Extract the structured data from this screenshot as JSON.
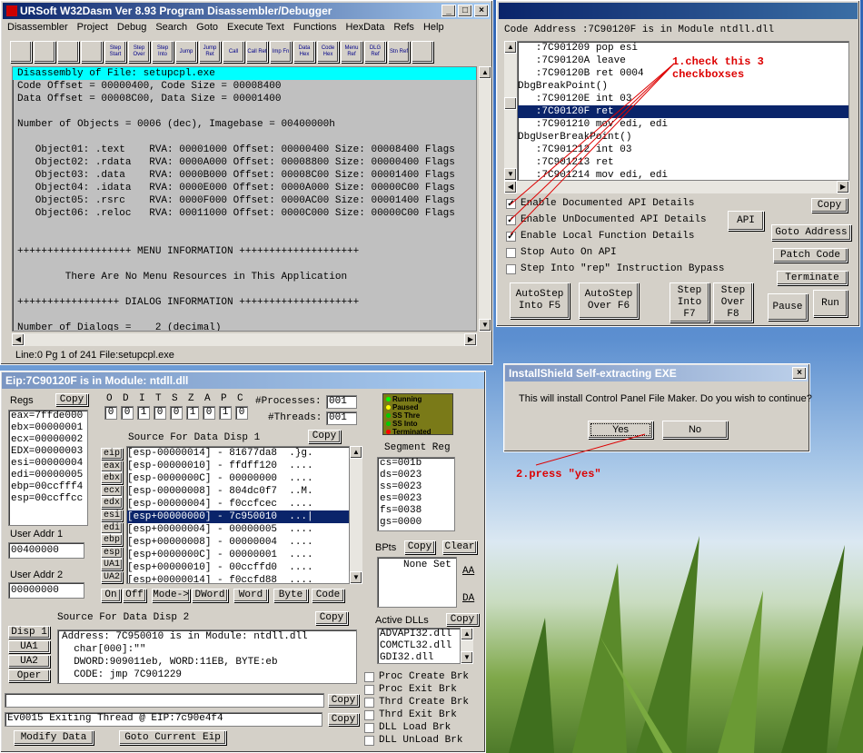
{
  "w32dasm": {
    "title": "URSoft W32Dasm Ver 8.93 Program Disassembler/Debugger",
    "menu": [
      "Disassembler",
      "Project",
      "Debug",
      "Search",
      "Goto",
      "Execute Text",
      "Functions",
      "HexData",
      "Refs",
      "Help"
    ],
    "toolbar": [
      "",
      "",
      "",
      "",
      "Step Start",
      "Step Over",
      "Step Into",
      "Jump",
      "Jump Ret",
      "Call",
      "Call Ret",
      "Imp Fn",
      "Data Hex",
      "Code Hex",
      "Menu Ref",
      "DLG Ref",
      "Stn Ref",
      ""
    ],
    "lines": [
      "Disassembly of File: setupcpl.exe",
      "Code Offset = 00000400, Code Size = 00008400",
      "Data Offset = 00008C00, Data Size = 00001400",
      "",
      "Number of Objects = 0006 (dec), Imagebase = 00400000h",
      "",
      "   Object01: .text    RVA: 00001000 Offset: 00000400 Size: 00008400 Flags",
      "   Object02: .rdata   RVA: 0000A000 Offset: 00008800 Size: 00000400 Flags",
      "   Object03: .data    RVA: 0000B000 Offset: 00008C00 Size: 00001400 Flags",
      "   Object04: .idata   RVA: 0000E000 Offset: 0000A000 Size: 00000C00 Flags",
      "   Object05: .rsrc    RVA: 0000F000 Offset: 0000AC00 Size: 00001400 Flags",
      "   Object06: .reloc   RVA: 00011000 Offset: 0000C000 Size: 00000C00 Flags",
      "",
      "",
      "+++++++++++++++++++ MENU INFORMATION ++++++++++++++++++++",
      "",
      "        There Are No Menu Resources in This Application",
      "",
      "+++++++++++++++++ DIALOG INFORMATION ++++++++++++++++++++",
      "",
      "Number of Dialogs =    2 (decimal)"
    ],
    "status": "Line:0 Pg 1 of 241  File:setupcpl.exe"
  },
  "code": {
    "address": "Code Address :7C90120F is in Module ntdll.dll",
    "lines": [
      "   :7C901209 pop esi",
      "   :7C90120A leave",
      "   :7C90120B ret 0004",
      "DbgBreakPoint()",
      "   :7C90120E int 03",
      "   :7C90120F ret",
      "   :7C901210 mov edi, edi",
      "DbgUserBreakPoint()",
      "   :7C901212 int 03",
      "   :7C901213 ret",
      "   :7C901214 mov edi, edi"
    ],
    "options": [
      {
        "label": "Enable Documented API Details",
        "checked": "✓"
      },
      {
        "label": "Enable UnDocumented API Details",
        "checked": "✓"
      },
      {
        "label": "Enable Local Function Details",
        "checked": "✓"
      },
      {
        "label": "Stop Auto On API",
        "checked": ""
      },
      {
        "label": "Step Into \"rep\" Instruction Bypass",
        "checked": ""
      }
    ],
    "buttons": {
      "copy": "Copy",
      "api": "API",
      "goto": "Goto Address",
      "patch": "Patch Code",
      "terminate": "Terminate",
      "pause": "Pause",
      "run": "Run",
      "as_into": "AutoStep Into F5",
      "as_over": "AutoStep Over F6",
      "step_into": "Step Into F7",
      "step_over": "Step Over F8"
    },
    "annotation1": "1.check this 3",
    "annotation1b": "checkboxses"
  },
  "regs": {
    "title": "Eip:7C90120F is in Module: ntdll.dll",
    "regs_label": "Regs",
    "copy": "Copy",
    "values": [
      "eax=7ffde000",
      "ebx=00000001",
      "ecx=00000002",
      "EDX=00000003",
      "esi=00000004",
      "edi=00000005",
      "ebp=00ccfff4",
      "esp=00ccffcc"
    ],
    "flags_letters": [
      "O",
      "D",
      "I",
      "T",
      "S",
      "Z",
      "A",
      "P",
      "C"
    ],
    "flags_values": [
      "0",
      "0",
      "1",
      "0",
      "0",
      "1",
      "0",
      "1",
      "0"
    ],
    "processes_label": "#Processes:",
    "processes": "001",
    "threads_label": "#Threads:",
    "threads": "001",
    "legend": [
      "Running",
      "Paused",
      "SS Thre",
      "SS Into",
      "Terminated"
    ],
    "user1_label": "User Addr 1",
    "user1": "00400000",
    "user2_label": "User Addr 2",
    "user2": "00000000",
    "src1_label": "Source For Data Disp 1",
    "src1_copy": "Copy",
    "src1_regs": [
      "eip",
      "eax",
      "ebx",
      "ecx",
      "edx",
      "esi",
      "edi",
      "ebp",
      "esp",
      "UA1",
      "UA2"
    ],
    "src1_rows": [
      "[esp-00000014] - 81677da8  .}g.",
      "[esp-00000010] - ffdff120  ....",
      "[esp-0000000C] - 00000000  ....",
      "[esp-00000008] - 804dc0f7  ..M.",
      "[esp-00000004] - f0ccfcec  ....",
      "[esp+00000000] - 7c950010  ...|",
      "[esp+00000004] - 00000005  ....",
      "[esp+00000008] - 00000004  ....",
      "[esp+0000000C] - 00000001  ....",
      "[esp+00000010] - 00ccffd0  ....",
      "[esp+00000014] - f0ccfd88  ...."
    ],
    "disp_btns": [
      "On",
      "Off",
      "Mode->",
      "DWord",
      "Word",
      "Byte",
      "Code"
    ],
    "seg_label": "Segment Reg",
    "segs": [
      "cs=001b",
      "ds=0023",
      "ss=0023",
      "es=0023",
      "fs=0038",
      "gs=0000"
    ],
    "bpts_label": "BPts",
    "bpts_copy": "Copy",
    "bpts_clear": "Clear",
    "bpts_none": "None Set",
    "aa": "AA",
    "da": "DA",
    "src2_label": "Source For Data Disp 2",
    "src2_copy": "Copy",
    "src2_btns": [
      "Disp 1",
      "UA1",
      "UA2",
      "Oper"
    ],
    "src2_lines": [
      "Address: 7C950010 is in Module: ntdll.dll",
      "  char[000]:\"\"",
      "  DWORD:909011eb, WORD:11EB, BYTE:eb",
      "  CODE: jmp 7C901229"
    ],
    "dlls_label": "Active DLLs",
    "dlls_copy": "Copy",
    "dlls": [
      "ADVAPI32.dll",
      "COMCTL32.dll",
      "GDI32.dll"
    ],
    "brk": [
      "Proc Create Brk",
      "Proc Exit Brk",
      "Thrd Create Brk",
      "Thrd Exit Brk",
      "DLL Load Brk",
      "DLL UnLoad Brk"
    ],
    "copy1": "Copy",
    "copy2": "Copy",
    "event": "Ev0015 Exiting Thread @ EIP:7c90e4f4",
    "modify": "Modify Data",
    "goto_eip": "Goto Current Eip"
  },
  "dialog": {
    "title": "InstallShield Self-extracting EXE",
    "message": "This will install Control Panel File Maker. Do you wish to continue?",
    "yes": "Yes",
    "no": "No",
    "annotation2": "2.press \"yes\""
  }
}
